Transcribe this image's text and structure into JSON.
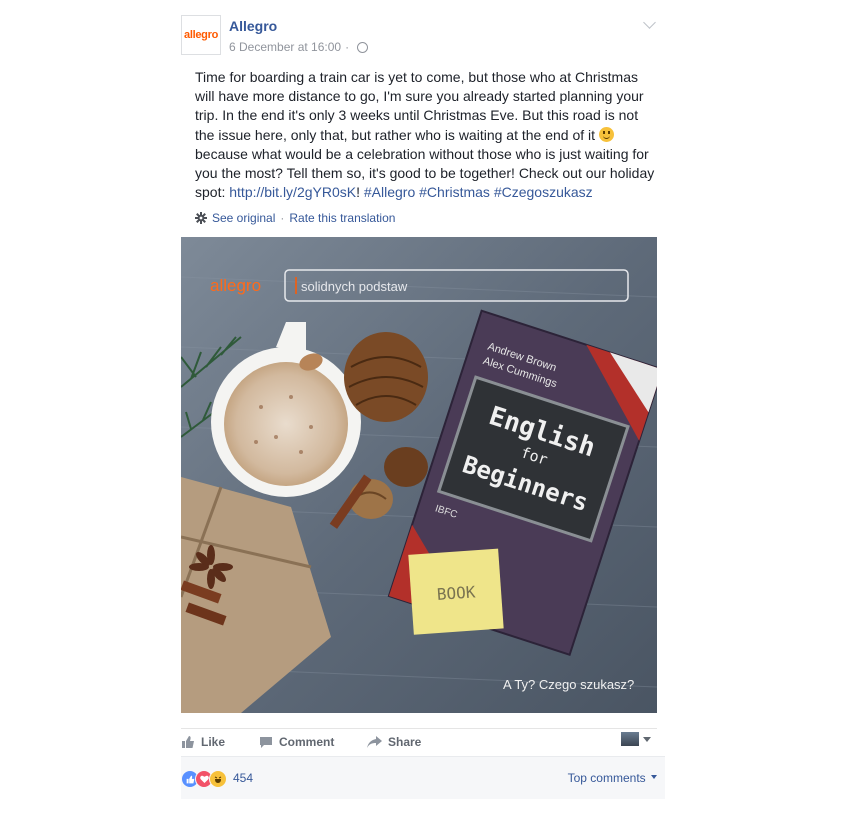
{
  "post": {
    "author": "Allegro",
    "logo_text": "allegro",
    "timestamp": "6 December at 16:00",
    "text_before_smiley": "Time for boarding a train car is yet to come, but those who at Christmas will have more distance to go, I'm sure you already started planning your trip. In the end it's only 3 weeks until Christmas Eve. But this road is not the issue here, only that, but rather who is waiting at the end of it ",
    "text_after_smiley": " because what would be a celebration without those who is just waiting for you the most? Tell them so, it's good to be together! Check out our holiday spot: ",
    "link": "http://bit.ly/2gYR0sK",
    "exclamation": "!",
    "hashtags": [
      "#Allegro",
      "#Christmas",
      "#Czegoszukasz"
    ],
    "see_original": "See original",
    "separator": "·",
    "rate_translation": "Rate this translation"
  },
  "photo": {
    "logo": "allegro",
    "search_text": "solidnych podstaw",
    "book_author1": "Andrew Brown",
    "book_author2": "Alex Cummings",
    "book_title1": "English",
    "book_title2": "for",
    "book_title3": "Beginners",
    "sticky_note": "BOOK",
    "ibfc": "IBFC",
    "caption": "A Ty? Czego szukasz?"
  },
  "actions": {
    "like": "Like",
    "comment": "Comment",
    "share": "Share"
  },
  "reactions": {
    "count": "454",
    "top_comments": "Top comments"
  },
  "colors": {
    "link": "#365899",
    "brand": "#ff5a00",
    "like_blue": "#5890ff",
    "love_red": "#f25268",
    "haha_yellow": "#f7c13a"
  }
}
